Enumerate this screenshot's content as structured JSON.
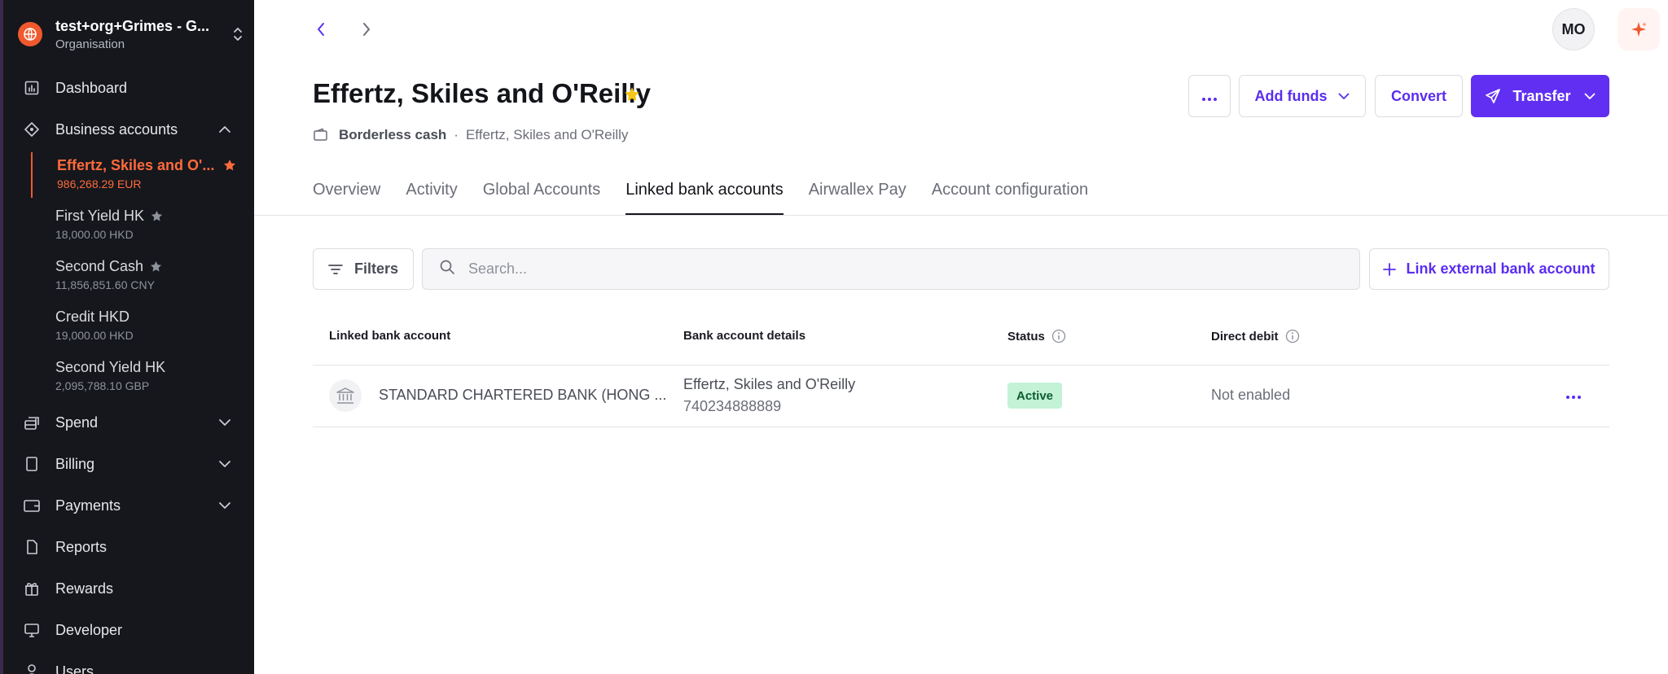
{
  "org": {
    "name": "test+org+Grimes - G...",
    "subtitle": "Organisation"
  },
  "sidebar": {
    "dashboard": "Dashboard",
    "business_accounts": "Business accounts",
    "accounts": [
      {
        "name": "Effertz, Skiles and O'...",
        "amount": "986,268.29 EUR"
      },
      {
        "name": "First Yield HK",
        "amount": "18,000.00 HKD"
      },
      {
        "name": "Second Cash",
        "amount": "11,856,851.60 CNY"
      },
      {
        "name": "Credit HKD",
        "amount": "19,000.00 HKD"
      },
      {
        "name": "Second Yield HK",
        "amount": "2,095,788.10 GBP"
      }
    ],
    "spend": "Spend",
    "billing": "Billing",
    "payments": "Payments",
    "reports": "Reports",
    "rewards": "Rewards",
    "developer": "Developer",
    "users": "Users"
  },
  "header": {
    "avatar_initials": "MO"
  },
  "page": {
    "title": "Effertz, Skiles and O'Reilly",
    "account_type": "Borderless cash",
    "separator": "·",
    "account_owner": "Effertz, Skiles and O'Reilly"
  },
  "actions": {
    "add_funds": "Add funds",
    "convert": "Convert",
    "transfer": "Transfer"
  },
  "tabs": [
    "Overview",
    "Activity",
    "Global Accounts",
    "Linked bank accounts",
    "Airwallex Pay",
    "Account configuration"
  ],
  "toolbar": {
    "filters": "Filters",
    "search_placeholder": "Search...",
    "link_account": "Link external bank account"
  },
  "table": {
    "headers": [
      "Linked bank account",
      "Bank account details",
      "Status",
      "Direct debit"
    ],
    "rows": [
      {
        "bank": "STANDARD CHARTERED BANK (HONG ...",
        "holder": "Effertz, Skiles and O'Reilly",
        "number": "740234888889",
        "status": "Active",
        "direct_debit": "Not enabled"
      }
    ]
  },
  "colors": {
    "accent": "#612ff2",
    "brand": "#f0592e",
    "sidebar_bg": "#15171c",
    "active_badge": "#c3f2d6",
    "star": "#f5c518"
  }
}
